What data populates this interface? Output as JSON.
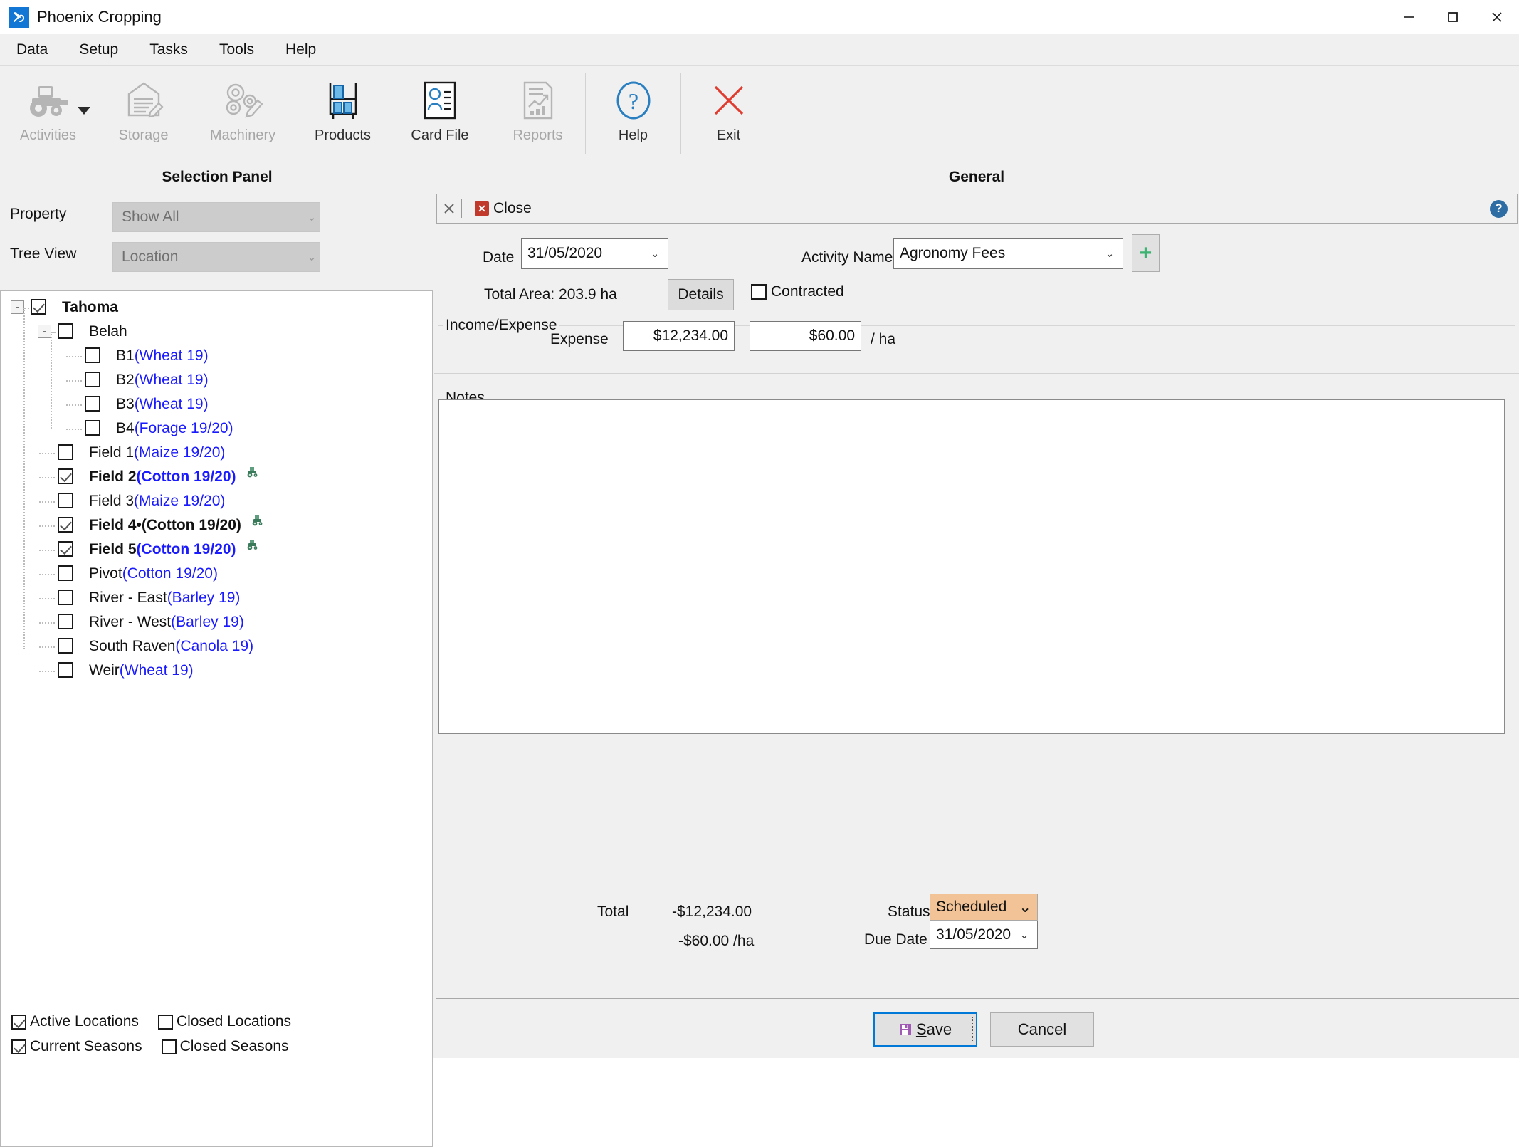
{
  "window": {
    "title": "Phoenix Cropping",
    "app_icon": "phoenix-logo-icon",
    "minimize": "minimize-icon",
    "maximize": "maximize-icon",
    "close": "close-icon"
  },
  "menubar": {
    "items": [
      {
        "label": "Data"
      },
      {
        "label": "Setup"
      },
      {
        "label": "Tasks"
      },
      {
        "label": "Tools"
      },
      {
        "label": "Help"
      }
    ]
  },
  "toolbar": {
    "buttons": [
      {
        "label": "Activities",
        "icon": "tractor-icon",
        "enabled": false,
        "has_dropdown": true
      },
      {
        "label": "Storage",
        "icon": "silo-document-icon",
        "enabled": false,
        "has_dropdown": false
      },
      {
        "label": "Machinery",
        "icon": "gears-pencil-icon",
        "enabled": false,
        "has_dropdown": false
      },
      {
        "label": "Products",
        "icon": "shelf-products-icon",
        "enabled": true,
        "has_dropdown": false
      },
      {
        "label": "Card File",
        "icon": "contact-card-icon",
        "enabled": true,
        "has_dropdown": false
      },
      {
        "label": "Reports",
        "icon": "report-chart-icon",
        "enabled": false,
        "has_dropdown": false
      },
      {
        "label": "Help",
        "icon": "question-circle-icon",
        "enabled": true,
        "has_dropdown": false
      },
      {
        "label": "Exit",
        "icon": "red-x-icon",
        "enabled": true,
        "has_dropdown": false
      }
    ]
  },
  "selection_panel": {
    "title": "Selection Panel",
    "property_label": "Property",
    "property_value": "Show All",
    "tree_view_label": "Tree View",
    "tree_view_value": "Location",
    "tree": [
      {
        "label": "Tahoma",
        "crop": "",
        "indent": 0,
        "checked": true,
        "bold": true,
        "expander": "-",
        "tractor": false,
        "all_black": false
      },
      {
        "label": "Belah",
        "crop": "",
        "indent": 1,
        "checked": false,
        "bold": false,
        "expander": "-",
        "tractor": false,
        "all_black": false
      },
      {
        "label": "B1",
        "crop": "(Wheat 19)",
        "indent": 2,
        "checked": false,
        "bold": false,
        "expander": "",
        "tractor": false,
        "all_black": false
      },
      {
        "label": "B2",
        "crop": "(Wheat 19)",
        "indent": 2,
        "checked": false,
        "bold": false,
        "expander": "",
        "tractor": false,
        "all_black": false
      },
      {
        "label": "B3",
        "crop": "(Wheat 19)",
        "indent": 2,
        "checked": false,
        "bold": false,
        "expander": "",
        "tractor": false,
        "all_black": false
      },
      {
        "label": "B4",
        "crop": "(Forage 19/20)",
        "indent": 2,
        "checked": false,
        "bold": false,
        "expander": "",
        "tractor": false,
        "all_black": false
      },
      {
        "label": "Field 1",
        "crop": "(Maize 19/20)",
        "indent": 1,
        "checked": false,
        "bold": false,
        "expander": "",
        "tractor": false,
        "all_black": false
      },
      {
        "label": "Field 2",
        "crop": "(Cotton 19/20)",
        "indent": 1,
        "checked": true,
        "bold": true,
        "expander": "",
        "tractor": true,
        "all_black": false
      },
      {
        "label": "Field 3",
        "crop": "(Maize 19/20)",
        "indent": 1,
        "checked": false,
        "bold": false,
        "expander": "",
        "tractor": false,
        "all_black": false
      },
      {
        "label": "Field 4•",
        "crop": "(Cotton 19/20)",
        "indent": 1,
        "checked": true,
        "bold": true,
        "expander": "",
        "tractor": true,
        "all_black": true
      },
      {
        "label": "Field 5",
        "crop": "(Cotton 19/20)",
        "indent": 1,
        "checked": true,
        "bold": true,
        "expander": "",
        "tractor": true,
        "all_black": false
      },
      {
        "label": "Pivot",
        "crop": "(Cotton 19/20)",
        "indent": 1,
        "checked": false,
        "bold": false,
        "expander": "",
        "tractor": false,
        "all_black": false
      },
      {
        "label": "River - East",
        "crop": "(Barley 19)",
        "indent": 1,
        "checked": false,
        "bold": false,
        "expander": "",
        "tractor": false,
        "all_black": false
      },
      {
        "label": "River - West",
        "crop": "(Barley 19)",
        "indent": 1,
        "checked": false,
        "bold": false,
        "expander": "",
        "tractor": false,
        "all_black": false
      },
      {
        "label": "South Raven",
        "crop": "(Canola 19)",
        "indent": 1,
        "checked": false,
        "bold": false,
        "expander": "",
        "tractor": false,
        "all_black": false
      },
      {
        "label": "Weir",
        "crop": "(Wheat 19)",
        "indent": 1,
        "checked": false,
        "bold": false,
        "expander": "",
        "tractor": false,
        "all_black": false
      }
    ],
    "footer_filters": [
      {
        "label": "Active Locations",
        "checked": true
      },
      {
        "label": "Closed Locations",
        "checked": false
      },
      {
        "label": "Current Seasons",
        "checked": true
      },
      {
        "label": "Closed Seasons",
        "checked": false
      }
    ]
  },
  "general_panel": {
    "title": "General",
    "close_label": "Close",
    "close_x_icon": "x-icon",
    "close_red_icon": "red-close-icon",
    "help_icon": "help-circle-icon",
    "date_label": "Date",
    "date_value": "31/05/2020",
    "activity_name_label": "Activity Name",
    "activity_name_value": "Agronomy Fees",
    "add_activity_icon": "plus-icon",
    "total_area_label": "Total Area: 203.9 ha",
    "details_button": "Details",
    "contracted_label": "Contracted",
    "contracted_checked": false,
    "income_expense_group": "Income/Expense",
    "expense_label": "Expense",
    "expense_total": "$12,234.00",
    "expense_per_ha": "$60.00",
    "per_ha_unit": "/ ha",
    "notes_group": "Notes",
    "notes_value": "",
    "total_label": "Total",
    "total_value": "-$12,234.00",
    "total_per_ha": "-$60.00 /ha",
    "status_label": "Status",
    "status_value": "Scheduled",
    "status_color": "#f2c396",
    "due_date_label": "Due Date",
    "due_date_value": "31/05/2020",
    "save_button": "Save",
    "save_icon": "floppy-disk-icon",
    "cancel_button": "Cancel"
  }
}
